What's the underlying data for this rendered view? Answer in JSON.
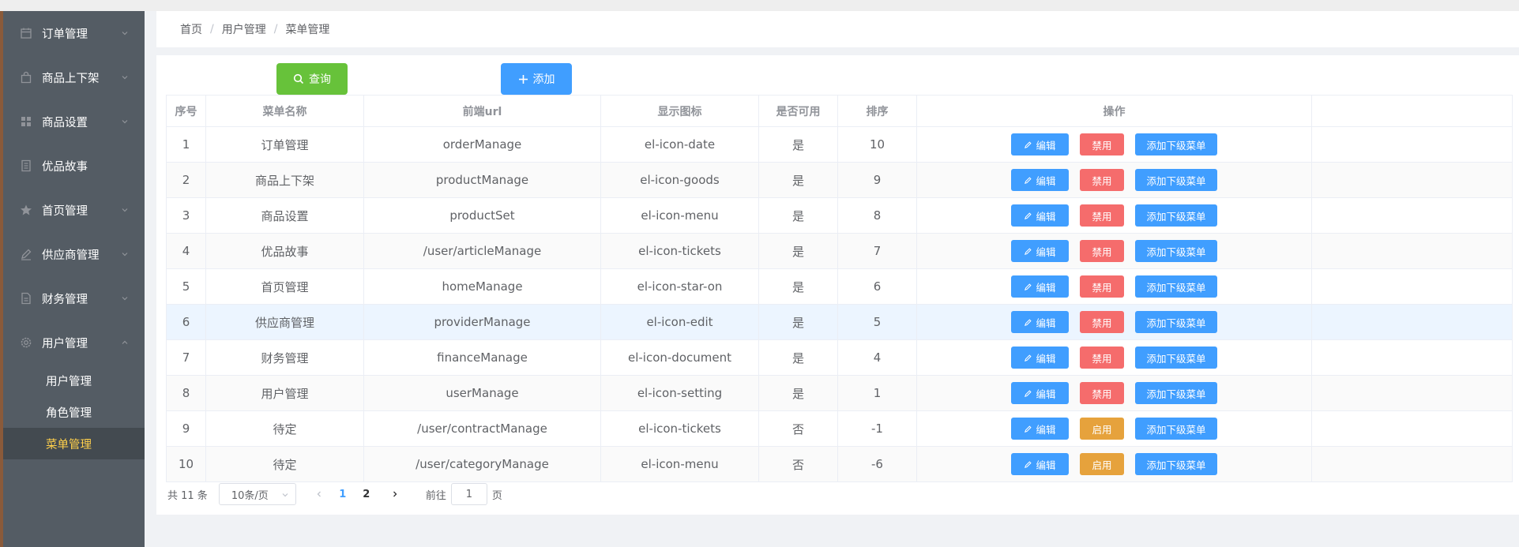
{
  "sidebar": {
    "items": [
      {
        "label": "订单管理",
        "icon": "calendar-icon",
        "has_children": true
      },
      {
        "label": "商品上下架",
        "icon": "goods-icon",
        "has_children": true
      },
      {
        "label": "商品设置",
        "icon": "menu-icon",
        "has_children": true
      },
      {
        "label": "优品故事",
        "icon": "tickets-icon",
        "has_children": false
      },
      {
        "label": "首页管理",
        "icon": "star-icon",
        "has_children": true
      },
      {
        "label": "供应商管理",
        "icon": "edit-icon",
        "has_children": true
      },
      {
        "label": "财务管理",
        "icon": "document-icon",
        "has_children": true
      },
      {
        "label": "用户管理",
        "icon": "setting-icon",
        "has_children": true,
        "expanded": true
      }
    ],
    "submenu": [
      {
        "label": "用户管理"
      },
      {
        "label": "角色管理"
      },
      {
        "label": "菜单管理",
        "active": true
      }
    ]
  },
  "breadcrumb": [
    "首页",
    "用户管理",
    "菜单管理"
  ],
  "toolbar": {
    "query_label": "查询",
    "add_label": "添加"
  },
  "table": {
    "headers": [
      "序号",
      "菜单名称",
      "前端url",
      "显示图标",
      "是否可用",
      "排序",
      "操作"
    ],
    "rows": [
      {
        "idx": "1",
        "name": "订单管理",
        "url": "orderManage",
        "icon": "el-icon-date",
        "enabled": "是",
        "sort": "10",
        "toggle": "禁用"
      },
      {
        "idx": "2",
        "name": "商品上下架",
        "url": "productManage",
        "icon": "el-icon-goods",
        "enabled": "是",
        "sort": "9",
        "toggle": "禁用"
      },
      {
        "idx": "3",
        "name": "商品设置",
        "url": "productSet",
        "icon": "el-icon-menu",
        "enabled": "是",
        "sort": "8",
        "toggle": "禁用"
      },
      {
        "idx": "4",
        "name": "优品故事",
        "url": "/user/articleManage",
        "icon": "el-icon-tickets",
        "enabled": "是",
        "sort": "7",
        "toggle": "禁用"
      },
      {
        "idx": "5",
        "name": "首页管理",
        "url": "homeManage",
        "icon": "el-icon-star-on",
        "enabled": "是",
        "sort": "6",
        "toggle": "禁用"
      },
      {
        "idx": "6",
        "name": "供应商管理",
        "url": "providerManage",
        "icon": "el-icon-edit",
        "enabled": "是",
        "sort": "5",
        "toggle": "禁用"
      },
      {
        "idx": "7",
        "name": "财务管理",
        "url": "financeManage",
        "icon": "el-icon-document",
        "enabled": "是",
        "sort": "4",
        "toggle": "禁用"
      },
      {
        "idx": "8",
        "name": "用户管理",
        "url": "userManage",
        "icon": "el-icon-setting",
        "enabled": "是",
        "sort": "1",
        "toggle": "禁用"
      },
      {
        "idx": "9",
        "name": "待定",
        "url": "/user/contractManage",
        "icon": "el-icon-tickets",
        "enabled": "否",
        "sort": "-1",
        "toggle": "启用"
      },
      {
        "idx": "10",
        "name": "待定",
        "url": "/user/categoryManage",
        "icon": "el-icon-menu",
        "enabled": "否",
        "sort": "-6",
        "toggle": "启用"
      }
    ],
    "edit_label": "编辑",
    "add_sub_label": "添加下级菜单"
  },
  "pagination": {
    "total_text": "共 11 条",
    "page_size": "10条/页",
    "pages": [
      "1",
      "2"
    ],
    "current_page": "1",
    "goto_label": "前往",
    "goto_value": "1",
    "page_suffix": "页"
  },
  "colors": {
    "sidebar_bg": "#545c64",
    "active_text": "#ffd04b",
    "primary": "#409eff",
    "success": "#67c23a",
    "danger": "#f56c6c",
    "warning": "#e6a23c"
  }
}
